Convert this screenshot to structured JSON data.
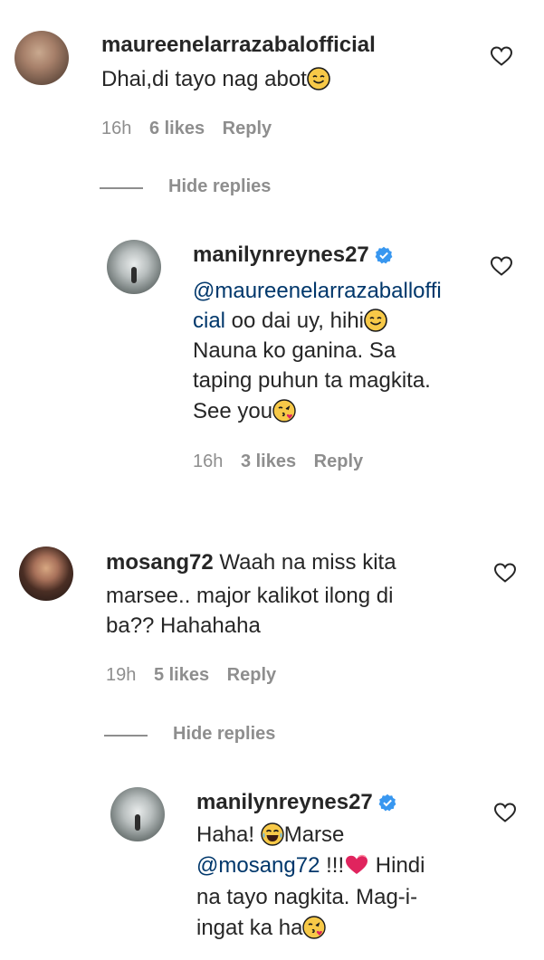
{
  "comments": [
    {
      "username": "maureenelarrazabalofficial",
      "text": "Dhai,di tayo nag abot",
      "emoji": "smiling-face",
      "time": "16h",
      "likes": "6 likes",
      "reply": "Reply",
      "hide_replies": "Hide replies",
      "replies": [
        {
          "username": "manilynreynes27",
          "mention_a": "@maureenelarrazaballoffi",
          "mention_b": "cial",
          "text_a": " oo dai uy, hihi",
          "line3": "Nauna ko ganina. Sa",
          "line4": "taping puhun ta magkita.",
          "line5": "See you",
          "time": "16h",
          "likes": "3 likes",
          "reply": "Reply"
        }
      ]
    },
    {
      "username": "mosang72",
      "text_line1": " Waah na miss kita",
      "text_line2": "marsee.. major kalikot ilong di",
      "text_line3": "ba?? Hahahaha",
      "time": "19h",
      "likes": "5 likes",
      "reply": "Reply",
      "hide_replies": "Hide replies",
      "replies": [
        {
          "username": "manilynreynes27",
          "line1_a": "Haha! ",
          "line1_b": "Marse",
          "mention": "@mosang72",
          "line2_b": " !!!",
          "line2_c": "  Hindi",
          "line3": "na tayo nagkita. Mag-i-",
          "line4": "ingat ka ha"
        }
      ]
    }
  ],
  "colors": {
    "text": "#262626",
    "meta": "#8e8e8e",
    "mention": "#00376b",
    "verified": "#3897f0"
  }
}
